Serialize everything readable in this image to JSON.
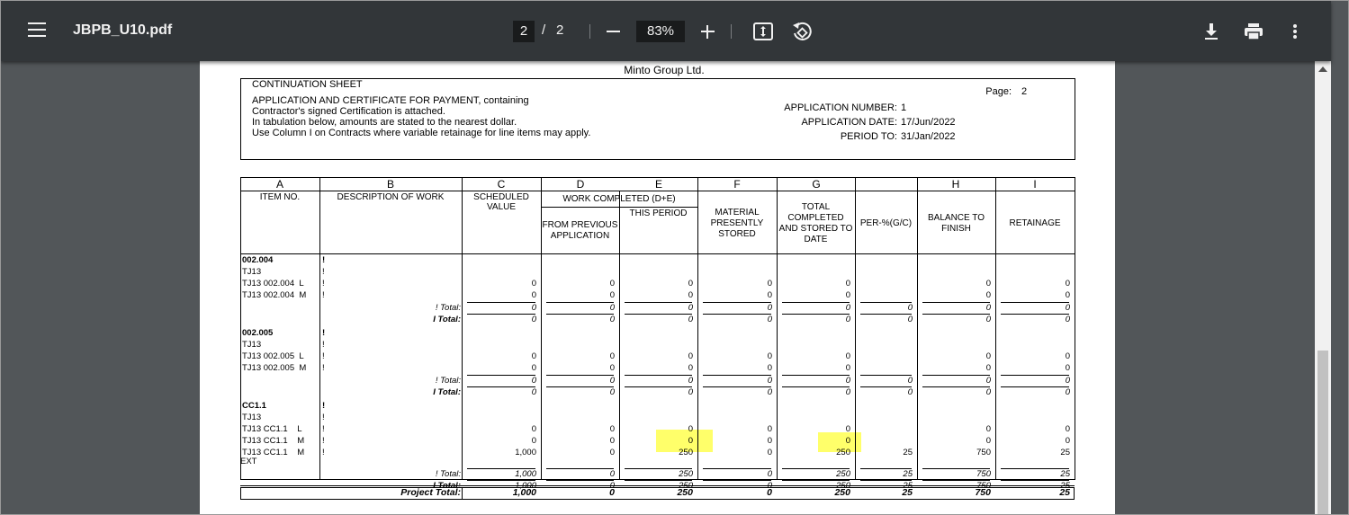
{
  "viewer": {
    "file_name": "JBPB_U10.pdf",
    "current_page": "2",
    "page_separator": "/",
    "total_pages": "2",
    "zoom": "83%",
    "icons": [
      "menu-icon",
      "zoom-out-icon",
      "zoom-in-icon",
      "fit-page-icon",
      "rotate-icon",
      "download-icon",
      "print-icon",
      "more-options-icon"
    ]
  },
  "document": {
    "company": "Minto Group Ltd.",
    "sheet_title": "CONTINUATION SHEET",
    "intro_lines": [
      "APPLICATION AND CERTIFICATE FOR PAYMENT, containing",
      "Contractor's signed Certification is attached.",
      "In tabulation below, amounts are stated to the nearest dollar.",
      "Use Column I on Contracts where variable retainage for line items may apply."
    ],
    "page_label": "Page:",
    "page_value": "2",
    "application_number_label": "APPLICATION NUMBER:",
    "application_number": "1",
    "application_date_label": "APPLICATION DATE:",
    "application_date": "17/Jun/2022",
    "period_to_label": "PERIOD TO:",
    "period_to": "31/Jan/2022"
  },
  "table": {
    "letters": [
      "A",
      "B",
      "C",
      "D",
      "E",
      "F",
      "G",
      "H",
      "I"
    ],
    "headers": {
      "item_no": "ITEM NO.",
      "description": "DESCRIPTION OF WORK",
      "scheduled_value": [
        "SCHEDULED",
        "VALUE"
      ],
      "work_completed": "WORK COMPLETED (D+E)",
      "from_previous": [
        "FROM PREVIOUS",
        "APPLICATION"
      ],
      "this_period": "THIS PERIOD",
      "material": [
        "MATERIAL",
        "PRESENTLY",
        "STORED"
      ],
      "total_completed": [
        "TOTAL",
        "COMPLETED",
        "AND STORED TO",
        "DATE"
      ],
      "percent": "PER-%(G/C)",
      "balance": [
        "BALANCE TO",
        "FINISH"
      ],
      "retainage": "RETAINAGE"
    },
    "group_marker": "!",
    "total_label": "! Total:",
    "group_total_label": "I Total:",
    "groups": [
      {
        "code": "002.004",
        "sub": "TJ13",
        "rows": [
          {
            "item": "TJ13 002.004  L",
            "values": [
              "0",
              "0",
              "0",
              "0",
              "0",
              "",
              "0",
              "0"
            ]
          },
          {
            "item": "TJ13 002.004  M",
            "values": [
              "0",
              "0",
              "0",
              "0",
              "0",
              "",
              "0",
              "0"
            ]
          }
        ],
        "total": [
          "0",
          "0",
          "0",
          "0",
          "0",
          "0",
          "0",
          "0"
        ],
        "group_total": [
          "0",
          "0",
          "0",
          "0",
          "0",
          "0",
          "0",
          "0"
        ]
      },
      {
        "code": "002.005",
        "sub": "TJ13",
        "rows": [
          {
            "item": "TJ13 002.005  L",
            "values": [
              "0",
              "0",
              "0",
              "0",
              "0",
              "",
              "0",
              "0"
            ]
          },
          {
            "item": "TJ13 002.005  M",
            "values": [
              "0",
              "0",
              "0",
              "0",
              "0",
              "",
              "0",
              "0"
            ]
          }
        ],
        "total": [
          "0",
          "0",
          "0",
          "0",
          "0",
          "0",
          "0",
          "0"
        ],
        "group_total": [
          "0",
          "0",
          "0",
          "0",
          "0",
          "0",
          "0",
          "0"
        ]
      },
      {
        "code": "CC1.1",
        "sub": "TJ13",
        "rows": [
          {
            "item": "TJ13 CC1.1    L",
            "values": [
              "0",
              "0",
              "0",
              "0",
              "0",
              "",
              "0",
              "0"
            ]
          },
          {
            "item": "TJ13 CC1.1    M",
            "values": [
              "0",
              "0",
              "0",
              "0",
              "0",
              "",
              "0",
              "0"
            ]
          },
          {
            "item": "TJ13 CC1.1    M",
            "item_line2": "EXT",
            "values": [
              "1,000",
              "0",
              "250",
              "0",
              "250",
              "25",
              "750",
              "25"
            ]
          }
        ],
        "total": [
          "1,000",
          "0",
          "250",
          "0",
          "250",
          "25",
          "750",
          "25"
        ],
        "group_total": [
          "1,000",
          "0",
          "250",
          "0",
          "250",
          "25",
          "750",
          "25"
        ]
      }
    ],
    "project_total_label": "Project Total:",
    "project_total": [
      "1,000",
      "0",
      "250",
      "0",
      "250",
      "25",
      "750",
      "25"
    ]
  },
  "highlight_color": "#ffff6a"
}
